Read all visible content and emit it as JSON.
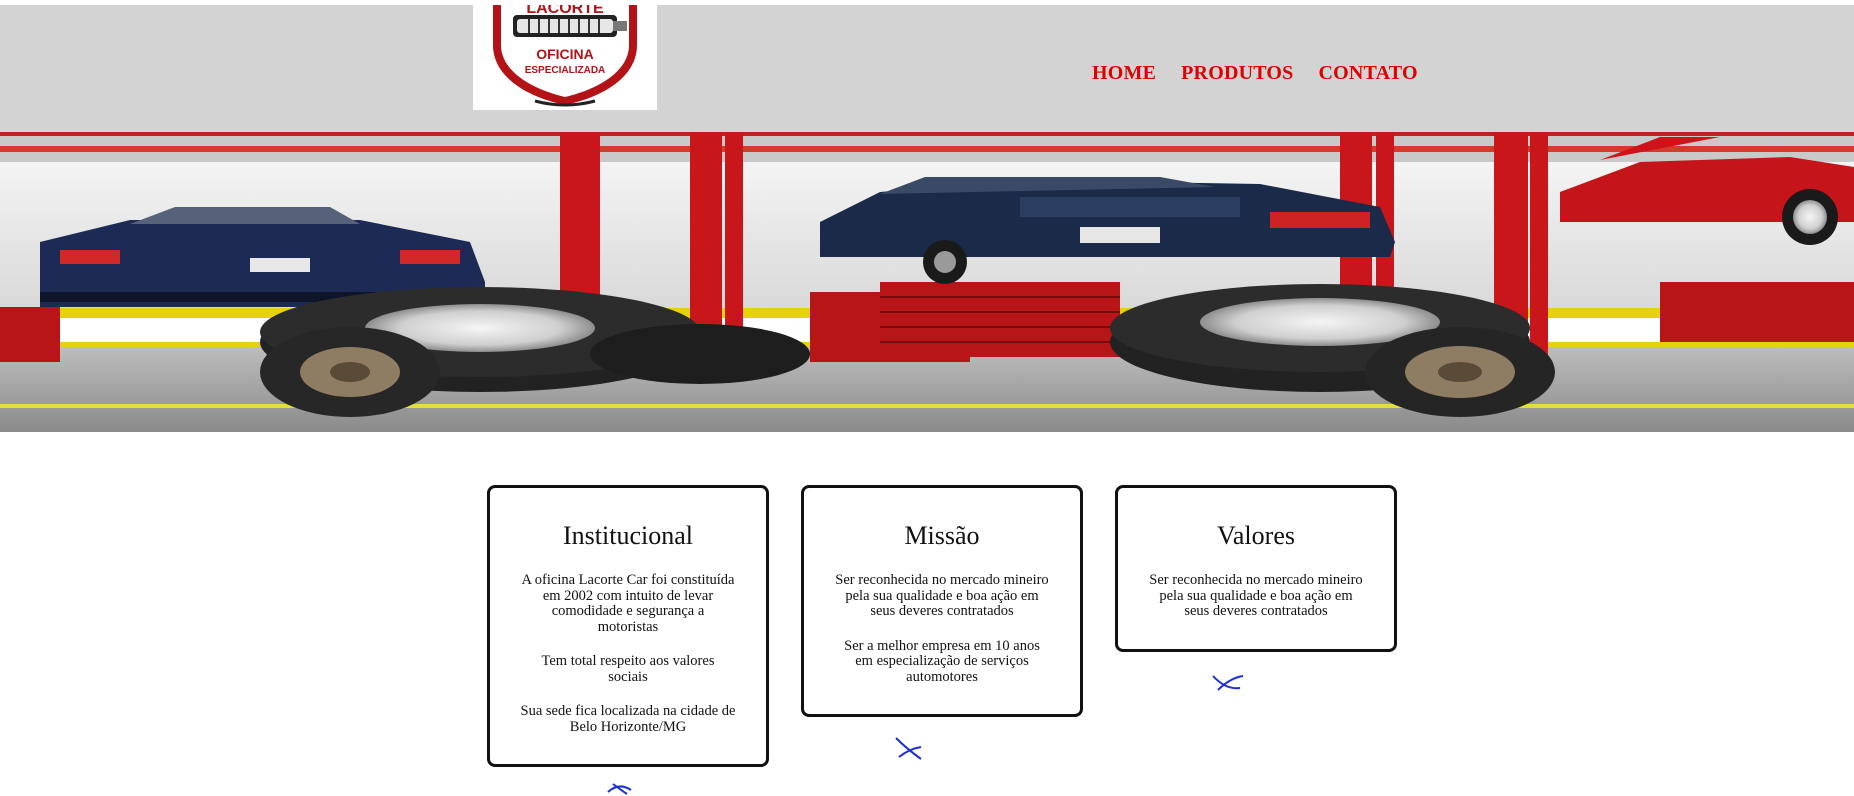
{
  "logo": {
    "brand_text": "LACORTE",
    "line1": "OFICINA",
    "line2": "ESPECIALIZADA"
  },
  "nav": {
    "items": [
      {
        "label": "HOME"
      },
      {
        "label": "PRODUTOS"
      },
      {
        "label": "CONTATO"
      }
    ]
  },
  "colors": {
    "header_bg": "#d3d3d3",
    "nav_text": "#e00000",
    "card_border": "#111111",
    "scribble": "#1a2fd6"
  },
  "cards": [
    {
      "title": "Institucional",
      "paragraphs": [
        "A oficina Lacorte Car foi constituída em 2002 com intuito de levar comodidade e segurança a motoristas",
        "Tem total respeito aos valores sociais",
        "Sua sede fica localizada na cidade de Belo Horizonte/MG"
      ]
    },
    {
      "title": "Missão",
      "paragraphs": [
        "Ser reconhecida no mercado mineiro pela sua qualidade e boa ação em seus deveres contratados",
        "Ser a melhor empresa em 10 anos em especialização de serviços automotores"
      ]
    },
    {
      "title": "Valores",
      "paragraphs": [
        "Ser reconhecida no mercado mineiro pela sua qualidade e boa ação em seus deveres contratados"
      ]
    }
  ]
}
